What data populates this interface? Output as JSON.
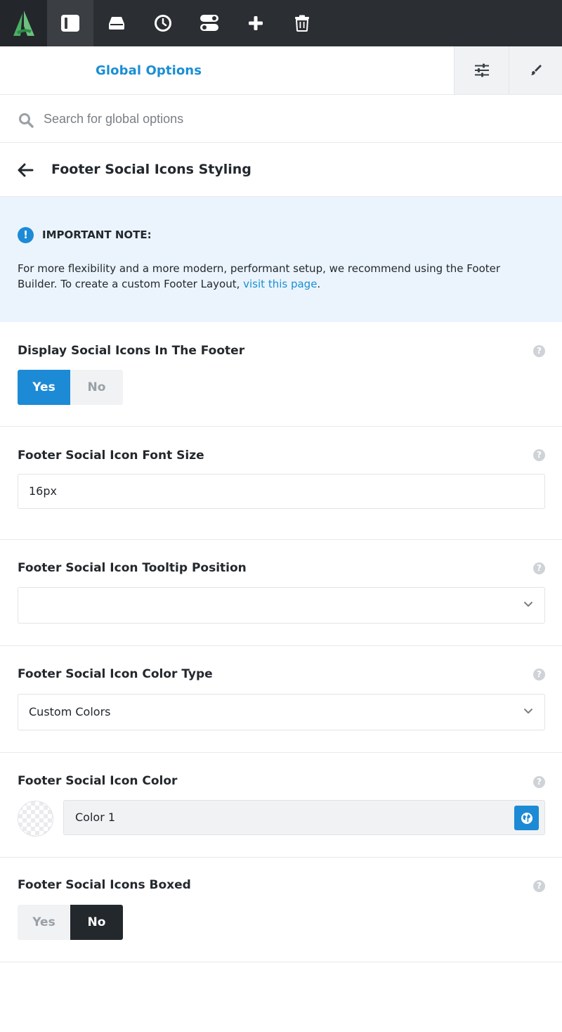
{
  "toolbar": {
    "items": [
      {
        "icon": "avada-logo-icon"
      },
      {
        "icon": "sidebar-panel-icon",
        "active": true
      },
      {
        "icon": "inbox-icon"
      },
      {
        "icon": "history-clock-icon"
      },
      {
        "icon": "toggles-icon"
      },
      {
        "icon": "plus-icon"
      },
      {
        "icon": "trash-icon"
      }
    ]
  },
  "header": {
    "title": "Global Options",
    "buttons": [
      {
        "icon": "sliders-icon"
      },
      {
        "icon": "brush-icon"
      }
    ]
  },
  "search": {
    "placeholder": "Search for global options",
    "value": ""
  },
  "section": {
    "title": "Footer Social Icons Styling"
  },
  "note": {
    "icon_text": "!",
    "title": "IMPORTANT NOTE:",
    "text_before": "For more flexibility and a more modern, performant setup, we recommend using the Footer Builder. To create a custom Footer Layout, ",
    "link_text": "visit this page",
    "text_after": "."
  },
  "options": {
    "display_icons": {
      "label": "Display Social Icons In The Footer",
      "yes": "Yes",
      "no": "No",
      "selected": "Yes"
    },
    "font_size": {
      "label": "Footer Social Icon Font Size",
      "value": "16px"
    },
    "tooltip_position": {
      "label": "Footer Social Icon Tooltip Position",
      "value": ""
    },
    "color_type": {
      "label": "Footer Social Icon Color Type",
      "value": "Custom Colors"
    },
    "icon_color": {
      "label": "Footer Social Icon Color",
      "value": "Color 1"
    },
    "boxed": {
      "label": "Footer Social Icons Boxed",
      "yes": "Yes",
      "no": "No",
      "selected": "No"
    }
  },
  "help_glyph": "?",
  "colors": {
    "accent": "#1d8ad6",
    "toolbar_bg": "#2b2f33",
    "note_bg": "#ebf4fd",
    "toggle_dark": "#23282d"
  }
}
